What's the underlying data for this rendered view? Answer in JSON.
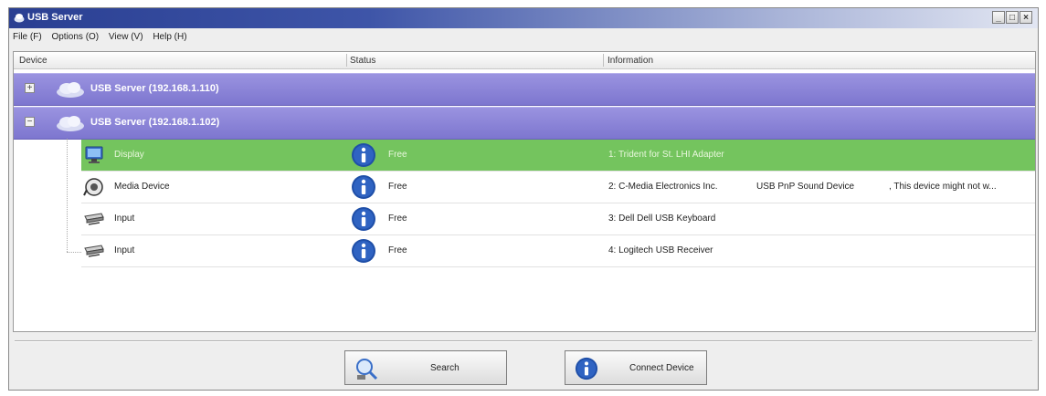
{
  "window": {
    "title": "USB Server",
    "controls": [
      "_",
      "□",
      "×"
    ]
  },
  "menu": [
    {
      "label": "File (F)"
    },
    {
      "label": "Options (O)"
    },
    {
      "label": "View (V)"
    },
    {
      "label": "Help (H)"
    }
  ],
  "columns": {
    "device": "Device",
    "status": "Status",
    "information": "Information"
  },
  "servers": [
    {
      "label": "USB Server (192.168.1.110)",
      "expander": "+",
      "expanded": false
    },
    {
      "label": "USB Server (192.168.1.102)",
      "expander": "−",
      "expanded": true
    }
  ],
  "devices": [
    {
      "name": "Display",
      "status": "Free",
      "info": "1: Trident for St. LHI Adapter",
      "info2": "",
      "info3": "",
      "icon": "display-icon",
      "selected": true
    },
    {
      "name": "Media Device",
      "status": "Free",
      "info": "2: C-Media Electronics Inc.",
      "info2": "USB PnP Sound Device",
      "info3": ", This device might not w...",
      "icon": "media-device-icon",
      "selected": false
    },
    {
      "name": "Input",
      "status": "Free",
      "info": "3: Dell Dell USB Keyboard",
      "info2": "",
      "info3": "",
      "icon": "input-device-icon",
      "selected": false
    },
    {
      "name": "Input",
      "status": "Free",
      "info": "4: Logitech USB Receiver",
      "info2": "",
      "info3": "",
      "icon": "input-device-icon",
      "selected": false
    }
  ],
  "buttons": {
    "search": "Search",
    "connect": "Connect Device"
  },
  "colors": {
    "title_bar": "#2a3f92",
    "server_row": "#8a83d8",
    "selected_row": "#74c45e",
    "info_icon": "#1f4fa8"
  }
}
